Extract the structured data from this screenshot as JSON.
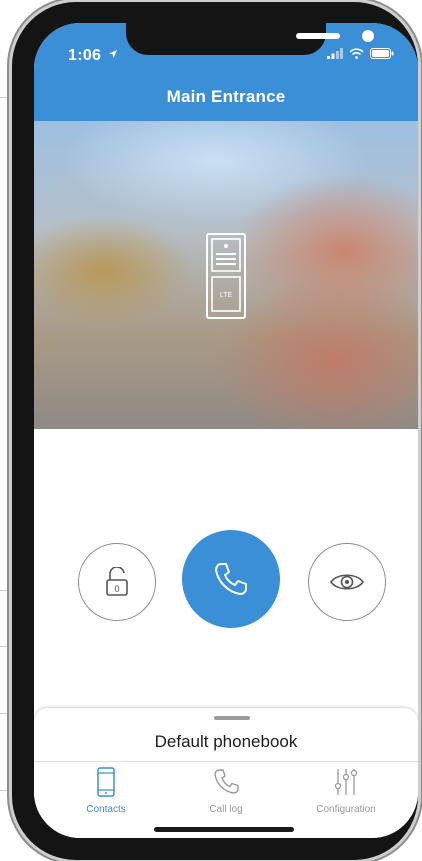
{
  "status_bar": {
    "time": "1:06",
    "location_icon": "location-arrow-icon",
    "icons": [
      "signal-icon",
      "wifi-icon",
      "battery-icon"
    ]
  },
  "header": {
    "title": "Main Entrance"
  },
  "camera": {
    "overlay_icon": "intercom-device-icon",
    "device_label": "LTE"
  },
  "controls": [
    {
      "name": "unlock",
      "icon": "unlock-icon"
    },
    {
      "name": "call",
      "icon": "phone-icon"
    },
    {
      "name": "view",
      "icon": "eye-icon"
    }
  ],
  "phonebook": {
    "title": "Default phonebook"
  },
  "tabs": [
    {
      "label": "Contacts",
      "icon": "smartphone-icon",
      "active": true
    },
    {
      "label": "Call log",
      "icon": "phone-icon",
      "active": false
    },
    {
      "label": "Configuration",
      "icon": "sliders-icon",
      "active": false
    }
  ],
  "colors": {
    "accent": "#3a8fd6",
    "inactive": "#9a9a9a",
    "lock_icon": "#555555"
  }
}
